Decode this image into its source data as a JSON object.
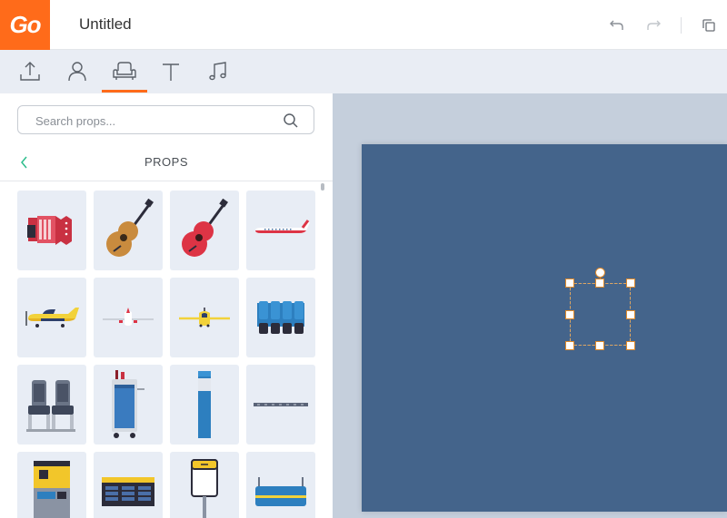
{
  "app": {
    "logo_text": "Go",
    "doc_title": "Untitled",
    "brand_color": "#ff6b1a"
  },
  "header_actions": [
    {
      "name": "undo-button",
      "icon": "undo-icon"
    },
    {
      "name": "redo-button",
      "icon": "redo-icon"
    },
    {
      "name": "duplicate-button",
      "icon": "duplicate-icon"
    }
  ],
  "tabs": [
    {
      "name": "tab-upload",
      "icon": "upload-icon",
      "active": false
    },
    {
      "name": "tab-characters",
      "icon": "person-icon",
      "active": false
    },
    {
      "name": "tab-props",
      "icon": "armchair-icon",
      "active": true
    },
    {
      "name": "tab-text",
      "icon": "text-icon",
      "active": false
    },
    {
      "name": "tab-music",
      "icon": "music-note-icon",
      "active": false
    }
  ],
  "search": {
    "placeholder": "Search props..."
  },
  "panel": {
    "title": "PROPS"
  },
  "props": [
    {
      "name": "accordion"
    },
    {
      "name": "acoustic-guitar"
    },
    {
      "name": "red-guitar"
    },
    {
      "name": "jet-airliner"
    },
    {
      "name": "yellow-propeller-plane"
    },
    {
      "name": "small-airliner"
    },
    {
      "name": "yellow-biplane"
    },
    {
      "name": "airport-seat-row"
    },
    {
      "name": "airplane-seats"
    },
    {
      "name": "drinks-trolley"
    },
    {
      "name": "airport-pillar"
    },
    {
      "name": "runway-strip"
    },
    {
      "name": "check-in-kiosk"
    },
    {
      "name": "departure-board"
    },
    {
      "name": "airport-sign"
    },
    {
      "name": "baggage-scanner"
    }
  ],
  "canvas": {
    "background": "#44648b"
  }
}
